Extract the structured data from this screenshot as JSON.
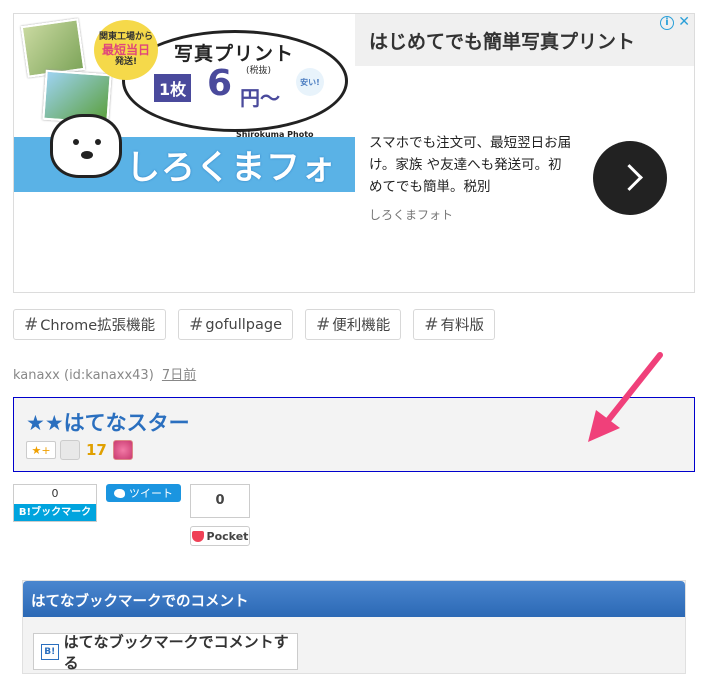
{
  "ad": {
    "badge_line1": "関東工場から",
    "badge_big": "最短当日",
    "badge_line3": "発送!",
    "bubble_title": "写真プリント",
    "count": "1枚",
    "price": "6",
    "tax": "(税抜)",
    "yen": "円〜",
    "yasui": "安い!",
    "brand": "しろくまフォト",
    "brand_sub": "Shirokuma Photo",
    "headline": "はじめてでも簡単写真プリント",
    "info_glyph": "i",
    "close_glyph": "✕",
    "description": "スマホでも注文可、最短翌日お届け。家族 や友達へも発送可。初めてでも簡単。税別",
    "advertiser": "しろくまフォト"
  },
  "tags": [
    {
      "hash": "#",
      "label": "Chrome拡張機能"
    },
    {
      "hash": "#",
      "label": "gofullpage"
    },
    {
      "hash": "#",
      "label": "便利機能"
    },
    {
      "hash": "#",
      "label": "有料版"
    }
  ],
  "meta": {
    "author": "kanaxx (id:kanaxx43)",
    "date": "7日前"
  },
  "star": {
    "title": "★★はてなスター",
    "add_label": "★+",
    "count": "17"
  },
  "share": {
    "hatena_count": "0",
    "hatena_label": "B!ブックマーク",
    "tweet_label": "ツイート",
    "pocket_count": "0",
    "pocket_label": "Pocket"
  },
  "comments": {
    "header": "はてなブックマークでのコメント",
    "button_label": "はてなブックマークでコメントする",
    "b_icon": "B!"
  },
  "colors": {
    "star_title": "#2a6fbf",
    "arrow": "#f0407a",
    "hatena_blue": "#00a4de",
    "twitter_blue": "#1b95e0",
    "pocket_red": "#ef4056"
  }
}
